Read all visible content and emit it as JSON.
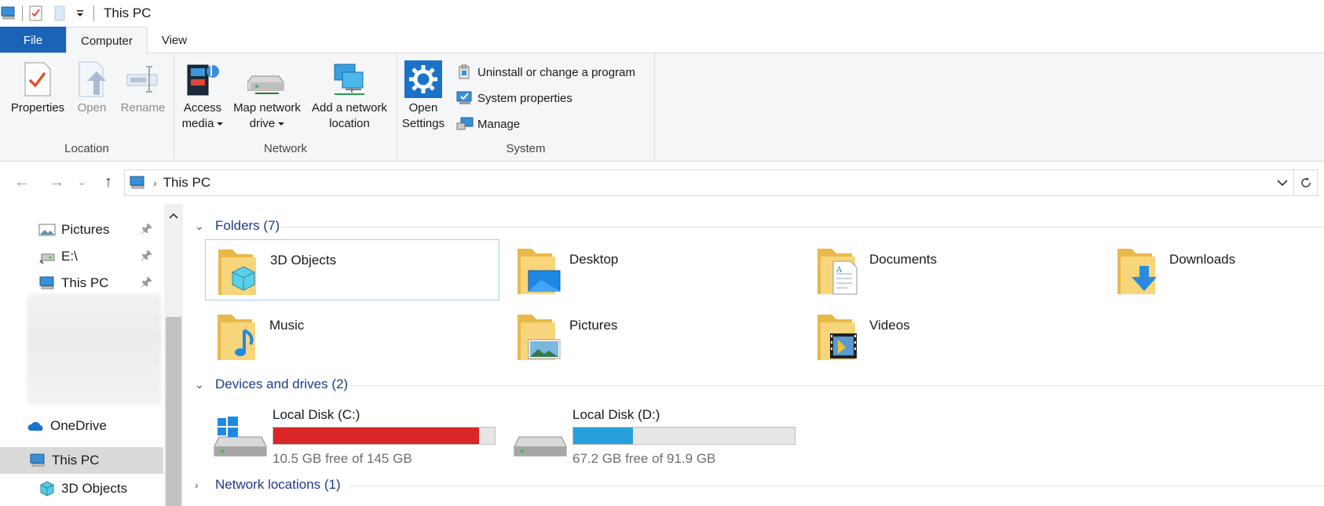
{
  "window": {
    "title": "This PC"
  },
  "tabs": {
    "file": "File",
    "computer": "Computer",
    "view": "View"
  },
  "ribbon": {
    "location": {
      "label": "Location",
      "properties": "Properties",
      "open": "Open",
      "rename": "Rename"
    },
    "network": {
      "label": "Network",
      "access_media_1": "Access",
      "access_media_2": "media",
      "map_drive_1": "Map network",
      "map_drive_2": "drive",
      "add_location_1": "Add a network",
      "add_location_2": "location"
    },
    "system": {
      "label": "System",
      "open_settings_1": "Open",
      "open_settings_2": "Settings",
      "uninstall": "Uninstall or change a program",
      "system_properties": "System properties",
      "manage": "Manage"
    }
  },
  "address": {
    "crumb": "This PC"
  },
  "sidebar": {
    "pictures": "Pictures",
    "edrive": "E:\\",
    "thispc_pinned": "This PC",
    "onedrive": "OneDrive",
    "thispc": "This PC",
    "objects3d": "3D Objects"
  },
  "content": {
    "folders_header": "Folders (7)",
    "folders": [
      "3D Objects",
      "Desktop",
      "Documents",
      "Downloads",
      "Music",
      "Pictures",
      "Videos"
    ],
    "devices_header": "Devices and drives (2)",
    "drives": [
      {
        "name": "Local Disk (C:)",
        "free": "10.5 GB free of 145 GB",
        "used_fraction": 0.928,
        "color": "#da2626"
      },
      {
        "name": "Local Disk (D:)",
        "free": "67.2 GB free of 91.9 GB",
        "used_fraction": 0.269,
        "color": "#26a0da"
      }
    ],
    "network_header": "Network locations (1)"
  },
  "colors": {
    "accent": "#1a63b6",
    "section": "#1e3a8a",
    "drive_full": "#da2626",
    "drive_ok": "#26a0da"
  }
}
